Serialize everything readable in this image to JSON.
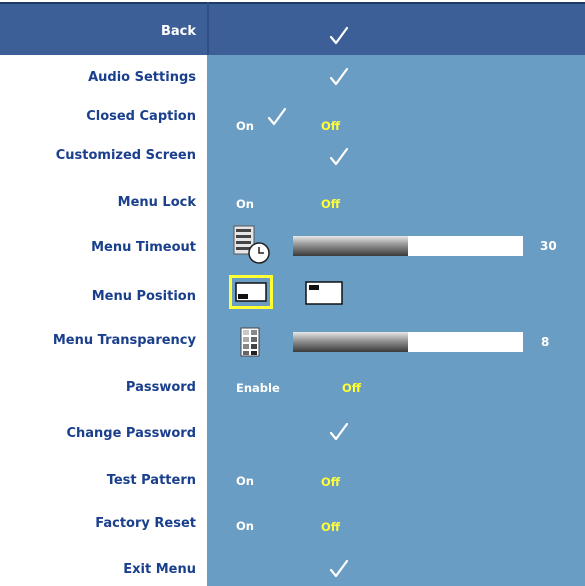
{
  "colors": {
    "panel": "#6a9dc3",
    "header": "#3b5f96",
    "label": "#1a3f8c",
    "selected": "#ffff33",
    "text": "#ffffff"
  },
  "header": {
    "back_label": "Back"
  },
  "rows": {
    "audio_settings": {
      "label": "Audio Settings"
    },
    "closed_caption": {
      "label": "Closed Caption",
      "on": "On",
      "off": "Off",
      "selected": "off"
    },
    "customized_screen": {
      "label": "Customized Screen"
    },
    "menu_lock": {
      "label": "Menu Lock",
      "on": "On",
      "off": "Off",
      "selected": "off"
    },
    "menu_timeout": {
      "label": "Menu Timeout",
      "value": "30",
      "level": 0.5,
      "icon": "clock-menu-icon"
    },
    "menu_position": {
      "label": "Menu Position",
      "selected_index": 0,
      "options": [
        "bottom-left-position-icon",
        "top-left-position-icon"
      ]
    },
    "menu_transparency": {
      "label": "Menu Transparency",
      "value": "8",
      "level": 0.5,
      "icon": "transparency-icon"
    },
    "password": {
      "label": "Password",
      "on": "Enable",
      "off": "Off",
      "selected": "off"
    },
    "change_password": {
      "label": "Change Password"
    },
    "test_pattern": {
      "label": "Test Pattern",
      "on": "On",
      "off": "Off",
      "selected": "off"
    },
    "factory_reset": {
      "label": "Factory Reset",
      "on": "On",
      "off": "Off",
      "selected": "off"
    },
    "exit_menu": {
      "label": "Exit Menu"
    }
  }
}
